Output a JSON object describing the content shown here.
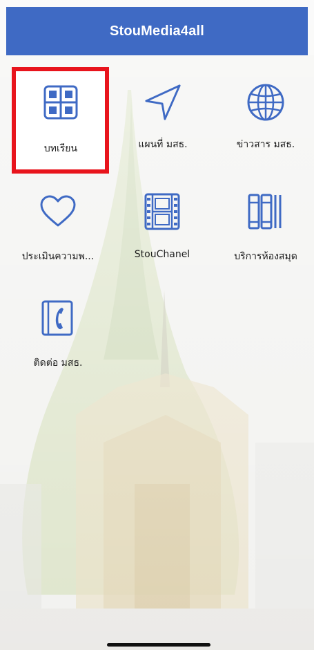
{
  "header": {
    "title": "StouMedia4all"
  },
  "menu": {
    "items": [
      {
        "label": "บทเรียน",
        "icon": "grid-icon"
      },
      {
        "label": "แผนที่ มสธ.",
        "icon": "navigation-arrow-icon"
      },
      {
        "label": "ข่าวสาร มสธ.",
        "icon": "globe-icon"
      },
      {
        "label": "ประเมินความพ...",
        "icon": "heart-icon"
      },
      {
        "label": "StouChanel",
        "icon": "film-icon"
      },
      {
        "label": "บริการห้องสมุด",
        "icon": "books-icon"
      },
      {
        "label": "ติดต่อ มสธ.",
        "icon": "phone-book-icon"
      }
    ]
  },
  "colors": {
    "brand": "#3f6ac4",
    "highlight": "#e8141c",
    "icon": "#3f6ac4"
  }
}
